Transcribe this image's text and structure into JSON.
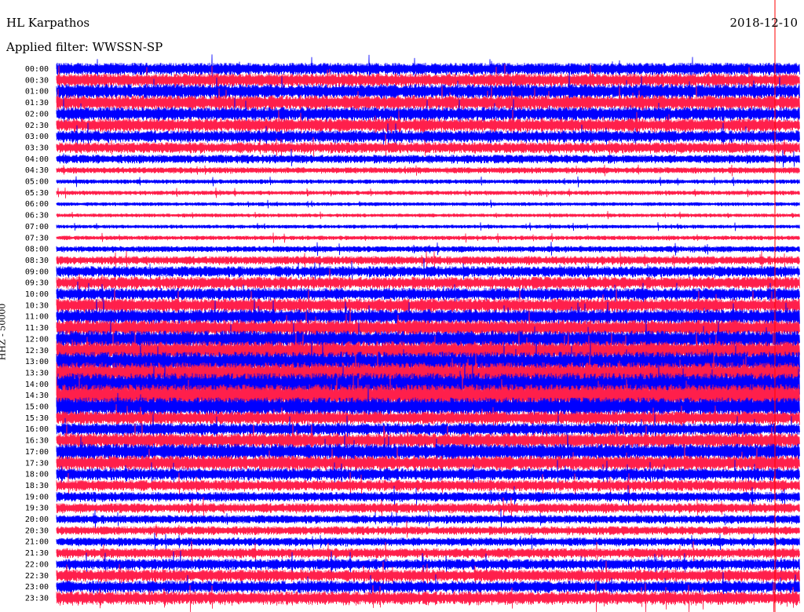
{
  "header": {
    "station": "HL Karpathos",
    "date": "2018-12-10",
    "filter": "Applied filter: WWSSN-SP"
  },
  "chart_data": {
    "type": "line",
    "title": "HL Karpathos",
    "ylabel": "HHZ - 50000",
    "series_colors": [
      "#0000ff",
      "#ff1f4b"
    ],
    "marker_color": "#ff0000",
    "rows": [
      {
        "label": "00:00",
        "color": "#0000ff",
        "amplitude": 1.0
      },
      {
        "label": "00:30",
        "color": "#ff1f4b",
        "amplitude": 1.1
      },
      {
        "label": "01:00",
        "color": "#0000ff",
        "amplitude": 1.2
      },
      {
        "label": "01:30",
        "color": "#ff1f4b",
        "amplitude": 1.2
      },
      {
        "label": "02:00",
        "color": "#0000ff",
        "amplitude": 1.1
      },
      {
        "label": "02:30",
        "color": "#ff1f4b",
        "amplitude": 1.1
      },
      {
        "label": "03:00",
        "color": "#0000ff",
        "amplitude": 1.0
      },
      {
        "label": "03:30",
        "color": "#ff1f4b",
        "amplitude": 0.9
      },
      {
        "label": "04:00",
        "color": "#0000ff",
        "amplitude": 0.7
      },
      {
        "label": "04:30",
        "color": "#ff1f4b",
        "amplitude": 0.5
      },
      {
        "label": "05:00",
        "color": "#0000ff",
        "amplitude": 0.35
      },
      {
        "label": "05:30",
        "color": "#ff1f4b",
        "amplitude": 0.35
      },
      {
        "label": "06:00",
        "color": "#0000ff",
        "amplitude": 0.3
      },
      {
        "label": "06:30",
        "color": "#ff1f4b",
        "amplitude": 0.3
      },
      {
        "label": "07:00",
        "color": "#0000ff",
        "amplitude": 0.3
      },
      {
        "label": "07:30",
        "color": "#ff1f4b",
        "amplitude": 0.35
      },
      {
        "label": "08:00",
        "color": "#0000ff",
        "amplitude": 0.5
      },
      {
        "label": "08:30",
        "color": "#ff1f4b",
        "amplitude": 0.7
      },
      {
        "label": "09:00",
        "color": "#0000ff",
        "amplitude": 0.9
      },
      {
        "label": "09:30",
        "color": "#ff1f4b",
        "amplitude": 1.0
      },
      {
        "label": "10:00",
        "color": "#0000ff",
        "amplitude": 1.0
      },
      {
        "label": "10:30",
        "color": "#ff1f4b",
        "amplitude": 1.1
      },
      {
        "label": "11:00",
        "color": "#0000ff",
        "amplitude": 1.2
      },
      {
        "label": "11:30",
        "color": "#ff1f4b",
        "amplitude": 1.3
      },
      {
        "label": "12:00",
        "color": "#0000ff",
        "amplitude": 1.4
      },
      {
        "label": "12:30",
        "color": "#ff1f4b",
        "amplitude": 1.5
      },
      {
        "label": "13:00",
        "color": "#0000ff",
        "amplitude": 1.6
      },
      {
        "label": "13:30",
        "color": "#ff1f4b",
        "amplitude": 1.7
      },
      {
        "label": "14:00",
        "color": "#0000ff",
        "amplitude": 1.8
      },
      {
        "label": "14:30",
        "color": "#ff1f4b",
        "amplitude": 1.8
      },
      {
        "label": "15:00",
        "color": "#0000ff",
        "amplitude": 1.5
      },
      {
        "label": "15:30",
        "color": "#ff1f4b",
        "amplitude": 1.1
      },
      {
        "label": "16:00",
        "color": "#0000ff",
        "amplitude": 1.0
      },
      {
        "label": "16:30",
        "color": "#ff1f4b",
        "amplitude": 1.2
      },
      {
        "label": "17:00",
        "color": "#0000ff",
        "amplitude": 1.3
      },
      {
        "label": "17:30",
        "color": "#ff1f4b",
        "amplitude": 1.2
      },
      {
        "label": "18:00",
        "color": "#0000ff",
        "amplitude": 1.0
      },
      {
        "label": "18:30",
        "color": "#ff1f4b",
        "amplitude": 0.9
      },
      {
        "label": "19:00",
        "color": "#0000ff",
        "amplitude": 0.8
      },
      {
        "label": "19:30",
        "color": "#ff1f4b",
        "amplitude": 0.8
      },
      {
        "label": "20:00",
        "color": "#0000ff",
        "amplitude": 0.7
      },
      {
        "label": "20:30",
        "color": "#ff1f4b",
        "amplitude": 0.7
      },
      {
        "label": "21:00",
        "color": "#0000ff",
        "amplitude": 0.7
      },
      {
        "label": "21:30",
        "color": "#ff1f4b",
        "amplitude": 0.8
      },
      {
        "label": "22:00",
        "color": "#0000ff",
        "amplitude": 0.9
      },
      {
        "label": "22:30",
        "color": "#ff1f4b",
        "amplitude": 1.0
      },
      {
        "label": "23:00",
        "color": "#0000ff",
        "amplitude": 1.0
      },
      {
        "label": "23:30",
        "color": "#ff1f4b",
        "amplitude": 1.1
      }
    ]
  }
}
